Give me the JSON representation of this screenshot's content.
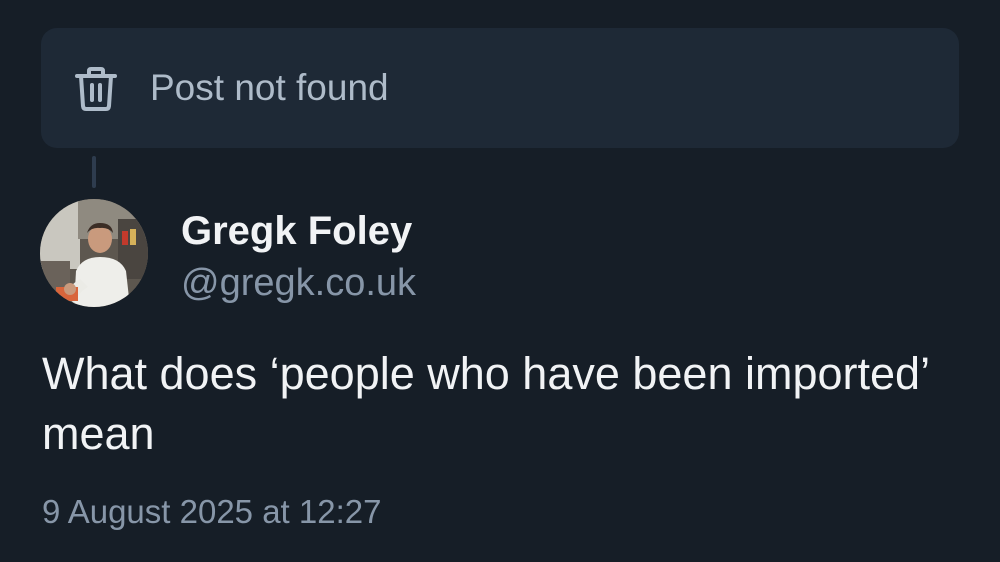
{
  "parent_notice": {
    "icon": "trash-icon",
    "text": "Post not found"
  },
  "post": {
    "author_name": "Gregk Foley",
    "author_handle": "@gregk.co.uk",
    "text": "What does ‘people who have been imported’ mean",
    "timestamp": "9 August 2025 at 12:27"
  },
  "colors": {
    "background": "#161e27",
    "notice_background": "#1e2936",
    "primary_text": "#f1f3f5",
    "secondary_text": "#8796a8",
    "notice_text": "#aebbc9"
  }
}
